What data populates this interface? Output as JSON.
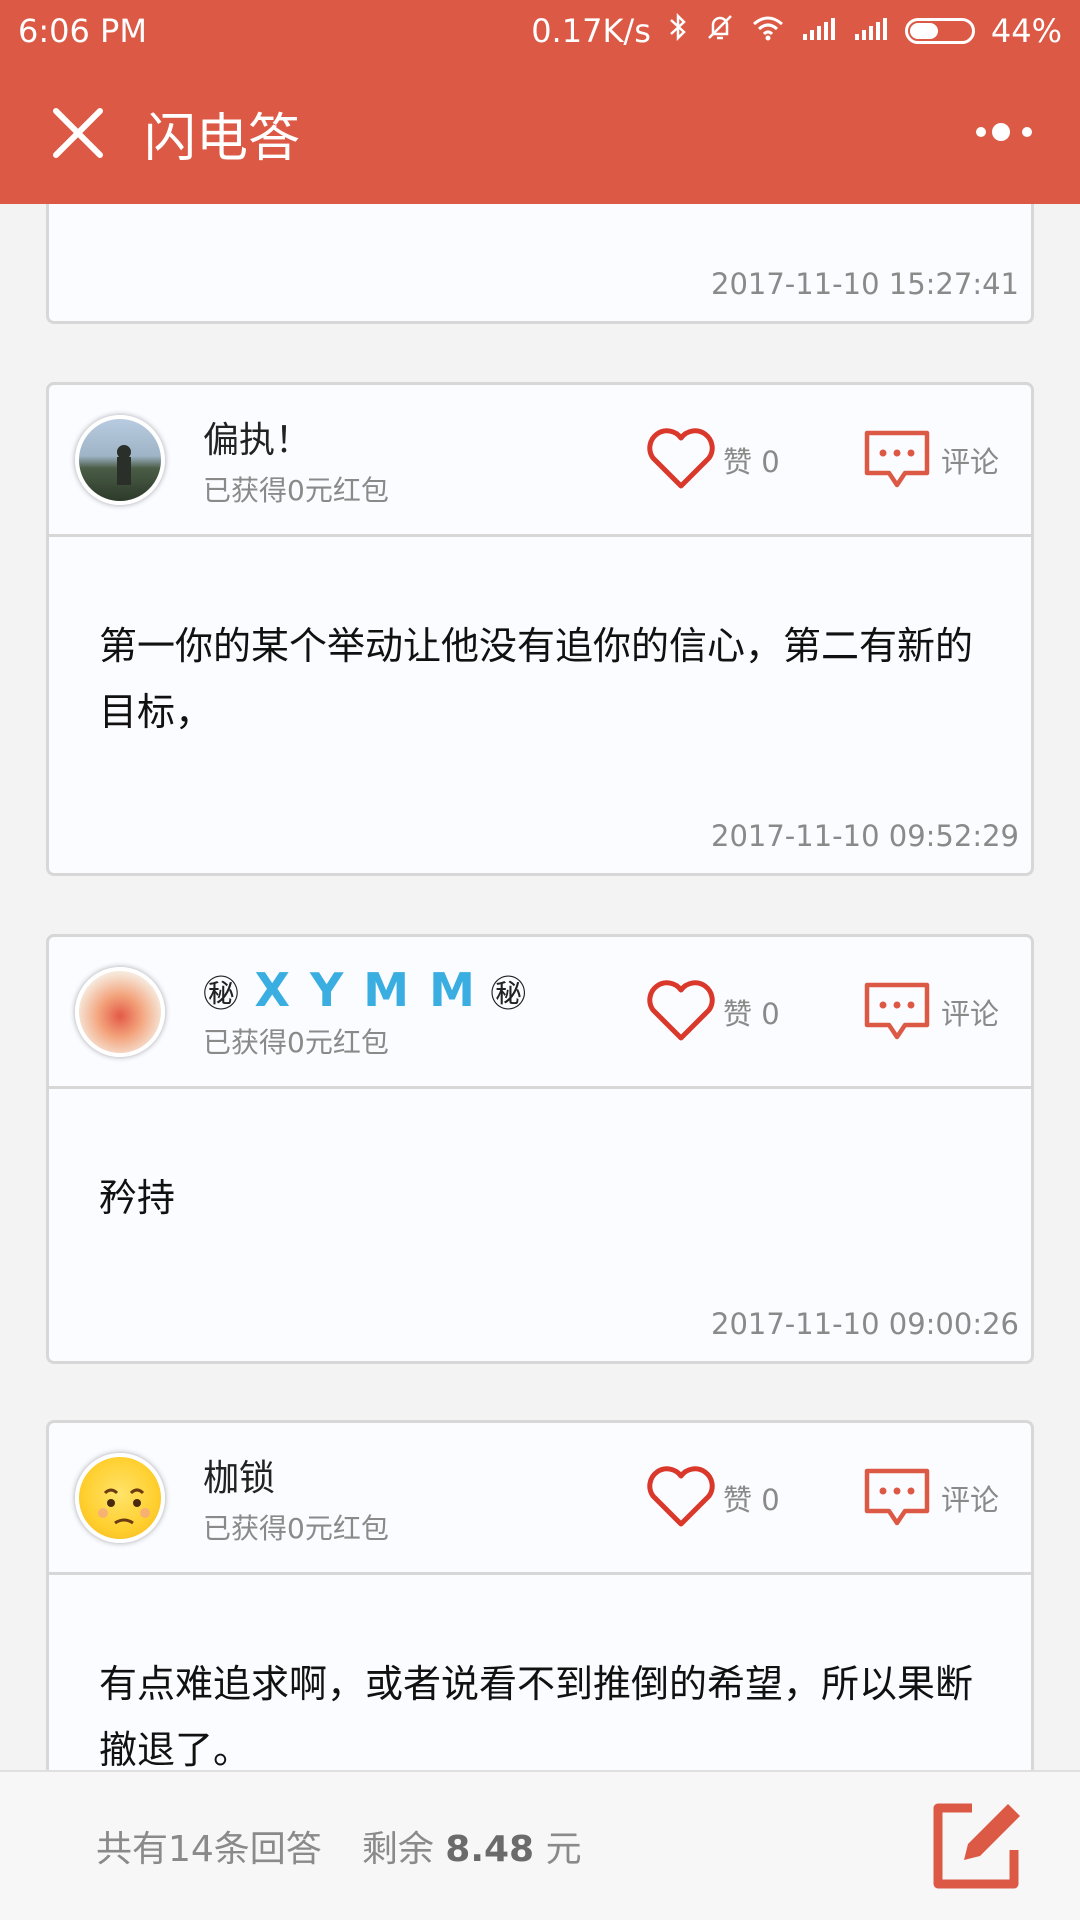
{
  "status_bar": {
    "time": "6:06 PM",
    "speed": "0.17K/s",
    "battery": "44%"
  },
  "header": {
    "title": "闪电答"
  },
  "partial_card": {
    "time": "2017-11-10 15:27:41"
  },
  "answers": [
    {
      "name": "偏执！",
      "earned": "已获得0元红包",
      "like_label": "赞 0",
      "comment_label": "评论",
      "content": "第一你的某个举动让他没有追你的信心，第二有新的目标，",
      "time": "2017-11-10 09:52:29"
    },
    {
      "name_prefix": "㊙",
      "name_main": "X Y M M",
      "name_suffix": "㊙",
      "earned": "已获得0元红包",
      "like_label": "赞 0",
      "comment_label": "评论",
      "content": "矜持",
      "time": "2017-11-10 09:00:26"
    },
    {
      "name": "枷锁",
      "earned": "已获得0元红包",
      "like_label": "赞 0",
      "comment_label": "评论",
      "content": "有点难追求啊，或者说看不到推倒的希望，所以果断撤退了。"
    }
  ],
  "bottom": {
    "total": "共有14条回答",
    "remain_prefix": "剩余",
    "remain_amount": "8.48",
    "remain_unit": "元"
  },
  "colors": {
    "brand": "#dc5946",
    "like": "#d9382b",
    "comment": "#dc5946"
  }
}
